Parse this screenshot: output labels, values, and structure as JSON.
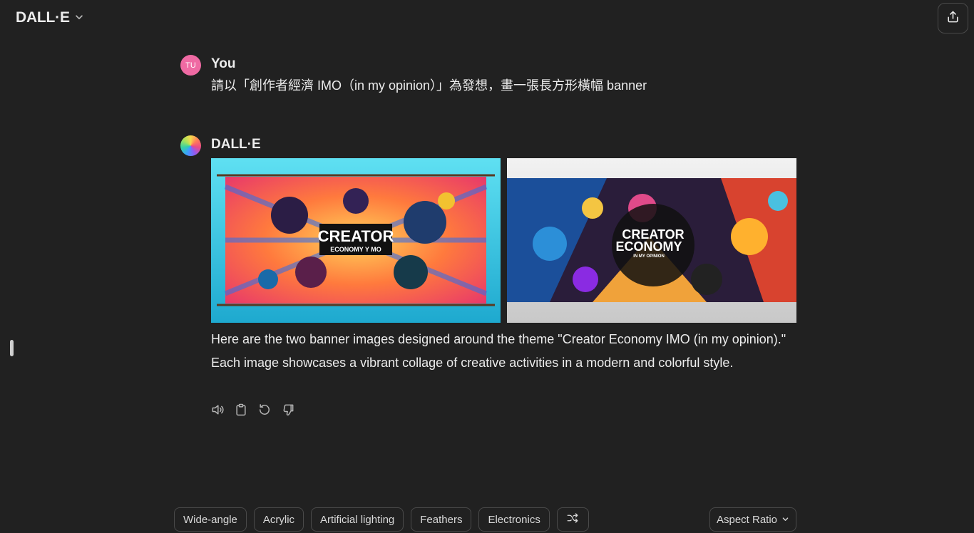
{
  "header": {
    "title": "DALL·E"
  },
  "user_message": {
    "avatar_initials": "TU",
    "sender": "You",
    "text": "請以「創作者經濟 IMO（in my opinion）」為發想，畫一張長方形橫幅 banner"
  },
  "assistant_message": {
    "sender": "DALL·E",
    "images": [
      {
        "title": "CREATOR",
        "subtitle": "ECONOMY Y MO"
      },
      {
        "title_line1": "CREATOR",
        "title_line2": "ECONOMY",
        "subtitle": "IN MY OPINION"
      }
    ],
    "text": "Here are the two banner images designed around the theme \"Creator Economy IMO (in my opinion).\" Each image showcases a vibrant collage of creative activities in a modern and colorful style."
  },
  "chips": [
    "Wide-angle",
    "Acrylic",
    "Artificial lighting",
    "Feathers",
    "Electronics"
  ],
  "aspect_ratio_label": "Aspect Ratio",
  "colors": {
    "background": "#212121",
    "text": "#ececec",
    "border": "#4a4a4a",
    "user_avatar": "#ef6aa3"
  },
  "icons": {
    "header_dropdown": "chevron-down-icon",
    "share": "share-icon",
    "actions": [
      "speaker-icon",
      "clipboard-icon",
      "regenerate-icon",
      "thumbs-down-icon"
    ],
    "shuffle": "shuffle-icon",
    "aspect_dropdown": "chevron-down-icon"
  }
}
